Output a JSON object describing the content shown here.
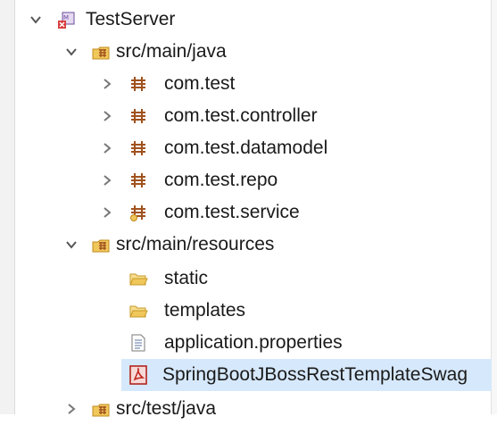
{
  "tree": {
    "project": {
      "label": "TestServer",
      "icon": "maven-project-icon",
      "expanded": true
    },
    "src_main_java": {
      "label": "src/main/java",
      "icon": "source-folder-icon",
      "expanded": true,
      "packages": [
        {
          "label": "com.test",
          "icon": "package-icon"
        },
        {
          "label": "com.test.controller",
          "icon": "package-icon"
        },
        {
          "label": "com.test.datamodel",
          "icon": "package-icon"
        },
        {
          "label": "com.test.repo",
          "icon": "package-icon"
        },
        {
          "label": "com.test.service",
          "icon": "package-icon"
        }
      ]
    },
    "src_main_resources": {
      "label": "src/main/resources",
      "icon": "source-folder-icon",
      "expanded": true,
      "items": [
        {
          "label": "static",
          "icon": "folder-icon"
        },
        {
          "label": "templates",
          "icon": "folder-icon"
        },
        {
          "label": "application.properties",
          "icon": "properties-file-icon"
        },
        {
          "label": "SpringBootJBossRestTemplateSwag",
          "icon": "pdf-file-icon",
          "selected": true
        }
      ]
    },
    "src_test_java": {
      "label": "src/test/java",
      "icon": "source-folder-icon",
      "expanded": false
    }
  },
  "colors": {
    "selection": "#d6e8fb",
    "text": "#1a1a1a",
    "package": "#a0521e",
    "folder": "#e8b84a"
  }
}
